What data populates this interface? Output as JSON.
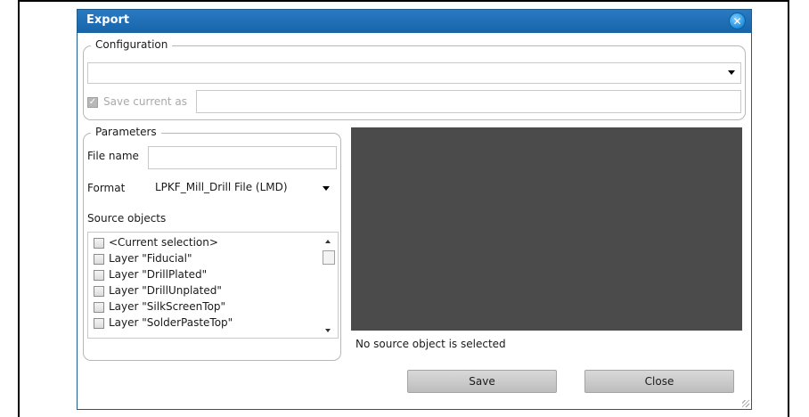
{
  "dialog": {
    "title": "Export",
    "close_icon": "close-icon"
  },
  "configuration": {
    "label": "Configuration",
    "selected_value": "",
    "save_current_as_label": "Save current as",
    "save_current_as_checked": true,
    "save_current_as_enabled": false,
    "save_name_value": ""
  },
  "parameters": {
    "label": "Parameters",
    "file_name_label": "File name",
    "file_name_value": "",
    "format_label": "Format",
    "format_value": "LPKF_Mill_Drill File (LMD)",
    "source_objects_label": "Source objects",
    "source_objects": [
      {
        "label": "<Current selection>",
        "checked": false
      },
      {
        "label": "Layer \"Fiducial\"",
        "checked": false
      },
      {
        "label": "Layer \"DrillPlated\"",
        "checked": false
      },
      {
        "label": "Layer \"DrillUnplated\"",
        "checked": false
      },
      {
        "label": "Layer \"SilkScreenTop\"",
        "checked": false
      },
      {
        "label": "Layer \"SolderPasteTop\"",
        "checked": false
      }
    ]
  },
  "preview": {
    "status_text": "No source object is selected",
    "background": "#4b4b4b"
  },
  "buttons": {
    "save_label": "Save",
    "close_label": "Close"
  },
  "colors": {
    "titlebar": "#1764a9",
    "accent": "#1d8fe0"
  }
}
